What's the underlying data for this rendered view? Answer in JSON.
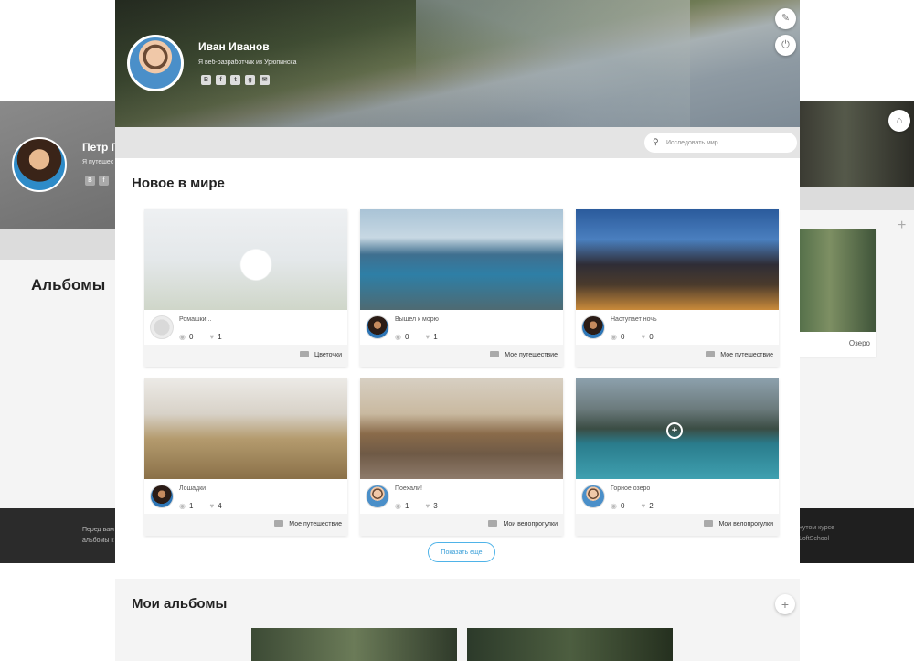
{
  "left_page": {
    "name": "Петр П",
    "subtitle": "Я путешес",
    "social": [
      "В",
      "f"
    ],
    "albums_title": "Альбомы",
    "footer_lines": [
      "Перед вам",
      "альбомы к"
    ]
  },
  "right_page": {
    "album_label": "Озеро",
    "footer_lines": [
      "нутом курсе",
      "LoftSchool"
    ]
  },
  "profile": {
    "name": "Иван Иванов",
    "tagline": "Я веб-разработчик из Урюпинска",
    "social": [
      "В",
      "f",
      "t",
      "g",
      "✉"
    ]
  },
  "search": {
    "placeholder": "Исследовать мир"
  },
  "feed": {
    "title": "Новое в мире",
    "cards": [
      {
        "title": "Ромашки...",
        "comments": "0",
        "likes": "1",
        "album": "Цветочки",
        "img": "daisies"
      },
      {
        "title": "Вышел к морю",
        "comments": "0",
        "likes": "1",
        "album": "Мое путешествие",
        "img": "sea"
      },
      {
        "title": "Наступает ночь",
        "comments": "0",
        "likes": "0",
        "album": "Мое путешествие",
        "img": "night"
      },
      {
        "title": "Лошадки",
        "comments": "1",
        "likes": "4",
        "album": "Мое путешествие",
        "img": "horses"
      },
      {
        "title": "Поехали!",
        "comments": "1",
        "likes": "3",
        "album": "Мои велопрогулки",
        "img": "bike"
      },
      {
        "title": "Горное озеро",
        "comments": "0",
        "likes": "2",
        "album": "Мои велопрогулки",
        "img": "lake"
      }
    ],
    "more_label": "Показать еще"
  },
  "my_albums": {
    "title": "Мои альбомы"
  },
  "colors": {
    "accent": "#4fb3e8",
    "section_bg": "#f4f4f4"
  }
}
